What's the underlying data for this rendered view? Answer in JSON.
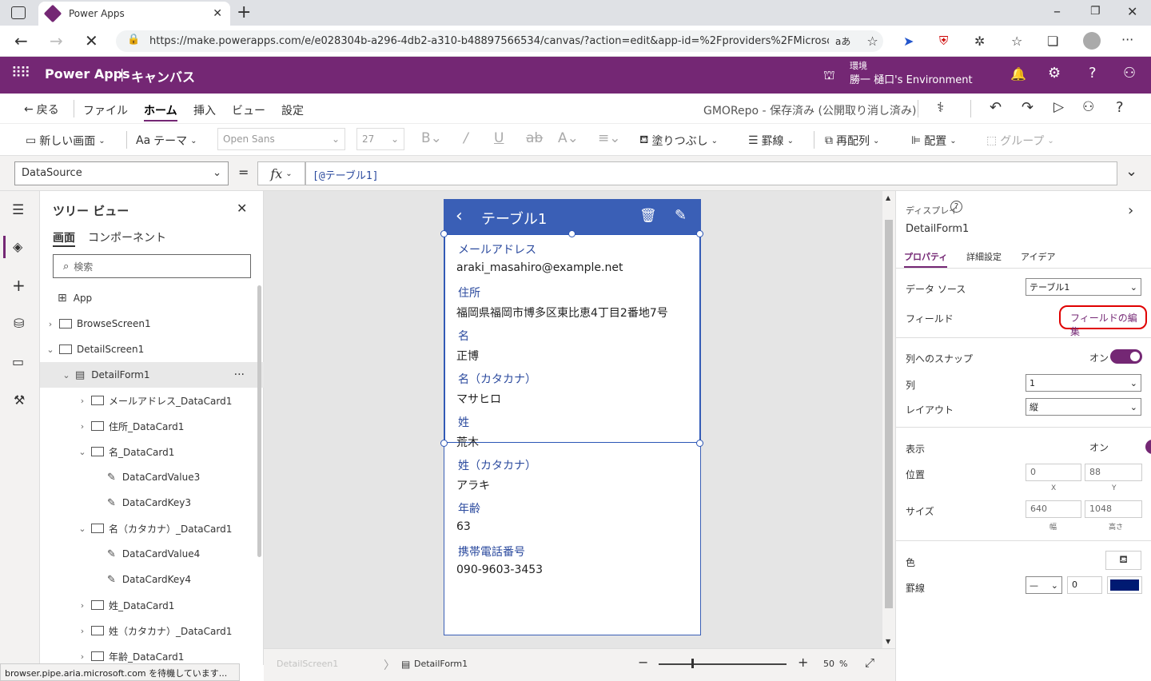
{
  "browser": {
    "tab_title": "Power Apps",
    "url": "https://make.powerapps.com/e/e028304b-a296-4db2-a310-b48897566534/canvas/?action=edit&app-id=%2Fproviders%2FMicrosoft....",
    "read_aloud": "aあ"
  },
  "header": {
    "app_name": "Power Apps",
    "separator": "|",
    "section": "キャンバス",
    "env_label": "環境",
    "env_name": "勝一 樋口's Environment"
  },
  "cmdbar": {
    "back": "戻る",
    "file": "ファイル",
    "home": "ホーム",
    "insert": "挿入",
    "view": "ビュー",
    "settings": "設定",
    "save_status": "GMORepo - 保存済み (公開取り消し済み)"
  },
  "ribbon": {
    "new_screen": "新しい画面",
    "theme": "テーマ",
    "font": "Open Sans",
    "font_size": "27",
    "fill": "塗りつぶし",
    "border": "罫線",
    "reorder": "再配列",
    "align": "配置",
    "group": "グループ"
  },
  "formula": {
    "property": "DataSource",
    "equals": "=",
    "fx": "fx",
    "value": "[@テーブル1]"
  },
  "tree": {
    "title": "ツリー ビュー",
    "tab_screens": "画面",
    "tab_components": "コンポーネント",
    "search_placeholder": "検索",
    "items": [
      {
        "label": "App"
      },
      {
        "label": "BrowseScreen1"
      },
      {
        "label": "DetailScreen1"
      },
      {
        "label": "DetailForm1"
      },
      {
        "label": "メールアドレス_DataCard1"
      },
      {
        "label": "住所_DataCard1"
      },
      {
        "label": "名_DataCard1"
      },
      {
        "label": "DataCardValue3"
      },
      {
        "label": "DataCardKey3"
      },
      {
        "label": "名（カタカナ）_DataCard1"
      },
      {
        "label": "DataCardValue4"
      },
      {
        "label": "DataCardKey4"
      },
      {
        "label": "姓_DataCard1"
      },
      {
        "label": "姓（カタカナ）_DataCard1"
      },
      {
        "label": "年齢_DataCard1"
      }
    ],
    "more": "···"
  },
  "form": {
    "title": "テーブル1",
    "fields": [
      {
        "label": "メールアドレス",
        "value": "araki_masahiro@example.net"
      },
      {
        "label": "住所",
        "value": "福岡県福岡市博多区東比恵4丁目2番地7号"
      },
      {
        "label": "名",
        "value": "正博"
      },
      {
        "label": "名（カタカナ）",
        "value": "マサヒロ"
      },
      {
        "label": "姓",
        "value": "荒木"
      },
      {
        "label": "姓（カタカナ）",
        "value": "アラキ"
      },
      {
        "label": "年齢",
        "value": "63"
      },
      {
        "label": "携帯電話番号",
        "value": "090-9603-3453"
      }
    ]
  },
  "props": {
    "display": "ディスプレイ",
    "control_name": "DetailForm1",
    "tab_properties": "プロパティ",
    "tab_advanced": "詳細設定",
    "tab_ideas": "アイデア",
    "datasource_label": "データ ソース",
    "datasource_value": "テーブル1",
    "fields_label": "フィールド",
    "edit_fields": "フィールドの編集",
    "snap_label": "列へのスナップ",
    "snap_state": "オン",
    "columns_label": "列",
    "columns_value": "1",
    "layout_label": "レイアウト",
    "layout_value": "縦",
    "visible_label": "表示",
    "visible_state": "オン",
    "position_label": "位置",
    "x": "0",
    "y": "88",
    "x_label": "X",
    "y_label": "Y",
    "size_label": "サイズ",
    "width": "640",
    "height": "1048",
    "width_label": "幅",
    "height_label": "高さ",
    "color_label": "色",
    "border_label": "罫線",
    "border_width": "0",
    "border_color": "#001a72"
  },
  "bottom": {
    "screen_crumb": "DetailScreen1",
    "form_crumb": "DetailForm1",
    "zoom": "50",
    "percent": "%"
  },
  "status": {
    "text": "browser.pipe.aria.microsoft.com を待機しています..."
  },
  "colors": {
    "brand": "#742774",
    "form_header": "#3a5fb6",
    "label": "#2b4a9e"
  }
}
